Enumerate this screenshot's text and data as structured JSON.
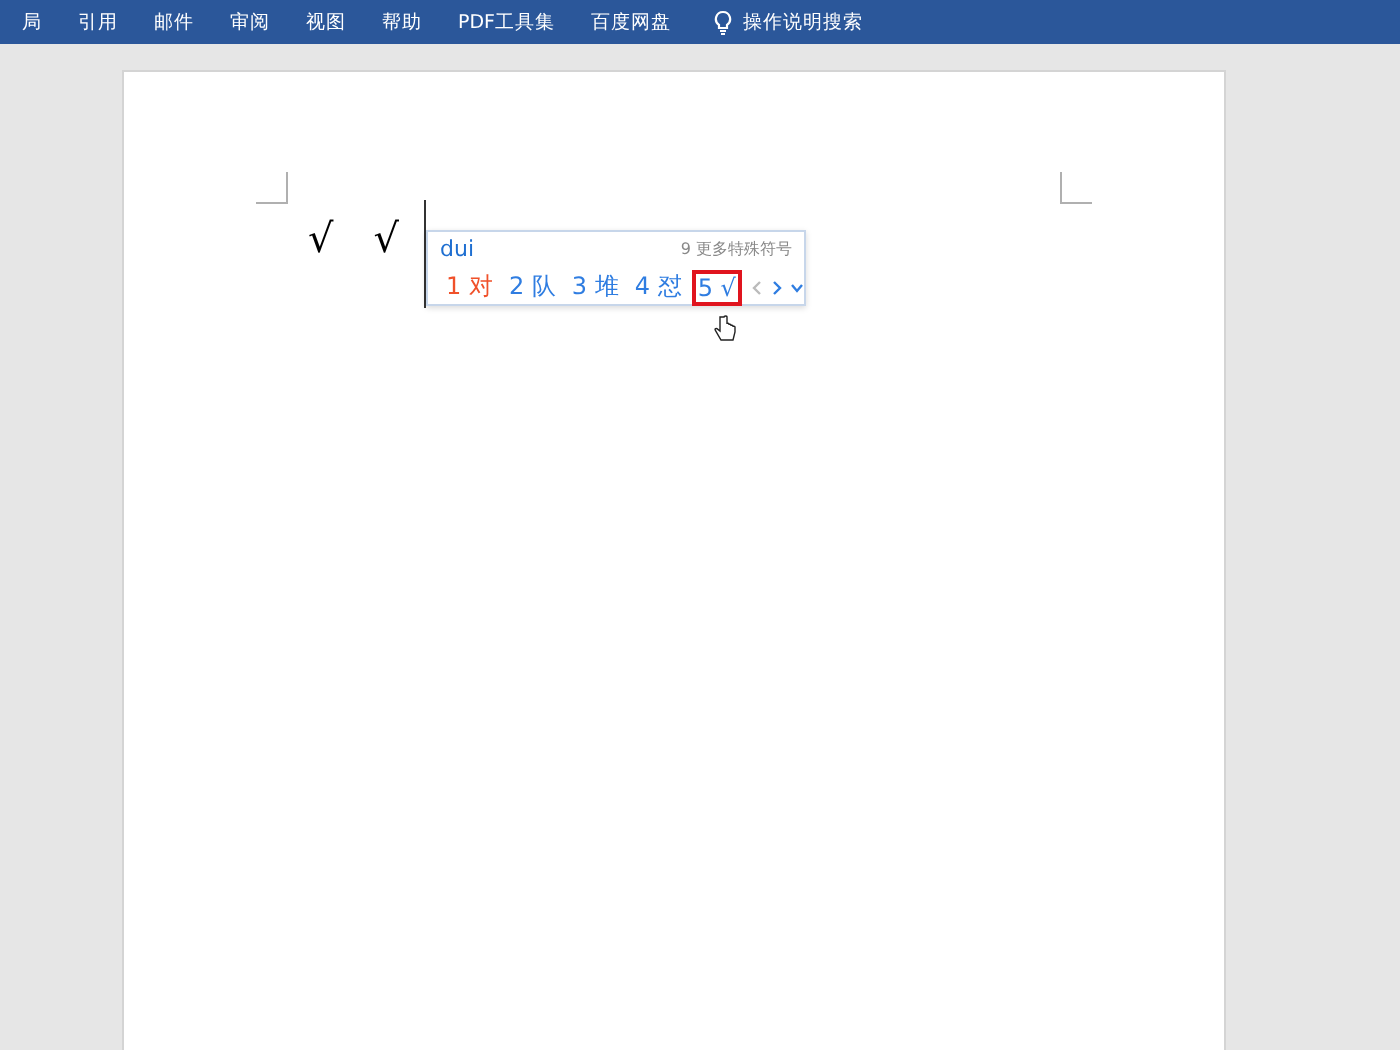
{
  "ribbon": {
    "tabs": [
      "局",
      "引用",
      "邮件",
      "审阅",
      "视图",
      "帮助",
      "PDF工具集",
      "百度网盘"
    ],
    "search": "操作说明搜索"
  },
  "document": {
    "marks": [
      "√",
      "√"
    ]
  },
  "ime": {
    "input": "dui",
    "more": "9 更多特殊符号",
    "candidates": [
      {
        "number": "1",
        "text": "对",
        "selected": true,
        "highlighted": false
      },
      {
        "number": "2",
        "text": "队",
        "selected": false,
        "highlighted": false
      },
      {
        "number": "3",
        "text": "堆",
        "selected": false,
        "highlighted": false
      },
      {
        "number": "4",
        "text": "怼",
        "selected": false,
        "highlighted": false
      },
      {
        "number": "5",
        "text": "√",
        "selected": false,
        "highlighted": true
      }
    ]
  }
}
